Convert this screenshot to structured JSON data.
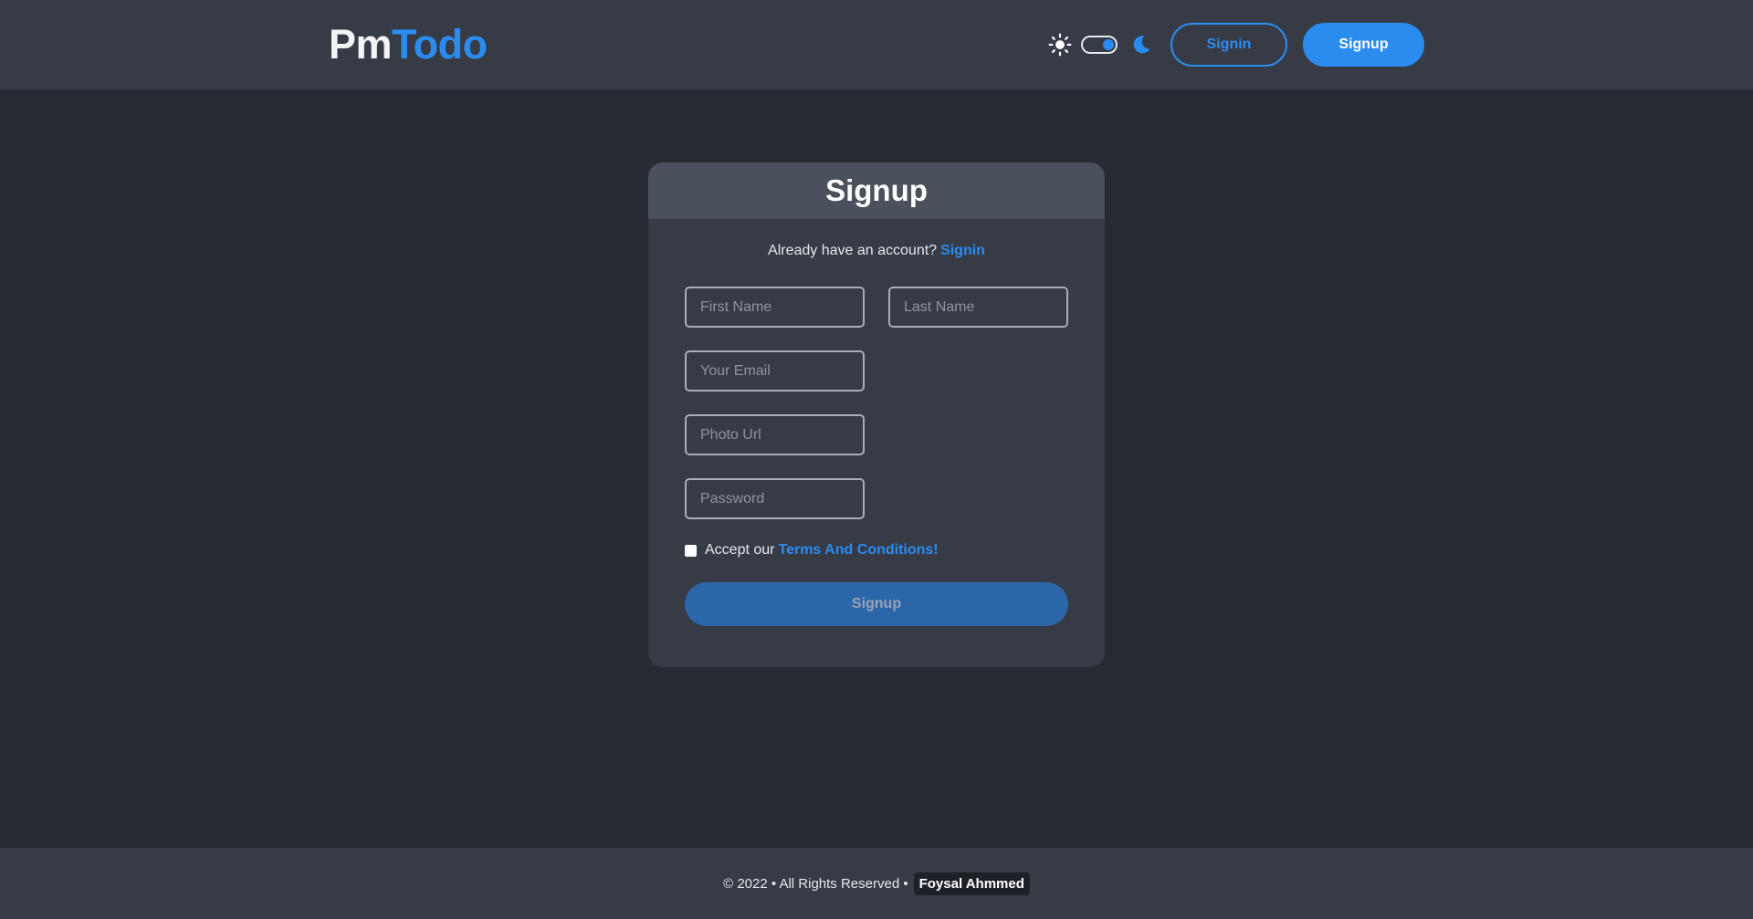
{
  "navbar": {
    "logo_part1": "Pm",
    "logo_part2": "Todo",
    "signin_label": "Signin",
    "signup_label": "Signup",
    "theme_toggle": {
      "left_icon": "sun-icon",
      "right_icon": "moon-icon",
      "state": "dark"
    }
  },
  "form": {
    "title": "Signup",
    "account_prompt": "Already have an account?",
    "account_link": "Signin",
    "first_name_placeholder": "First Name",
    "last_name_placeholder": "Last Name",
    "email_placeholder": "Your Email",
    "photo_placeholder": "Photo Url",
    "password_placeholder": "Password",
    "terms_prefix": "Accept our",
    "terms_link": "Terms And Conditions!",
    "submit_label": "Signup"
  },
  "footer": {
    "copyright": "© 2022 • All Rights Reserved •",
    "author": "Foysal Ahmmed"
  },
  "colors": {
    "accent": "#2b8cf0",
    "background": "#272b33",
    "surface": "#363b46",
    "card_header": "#4a505c"
  }
}
